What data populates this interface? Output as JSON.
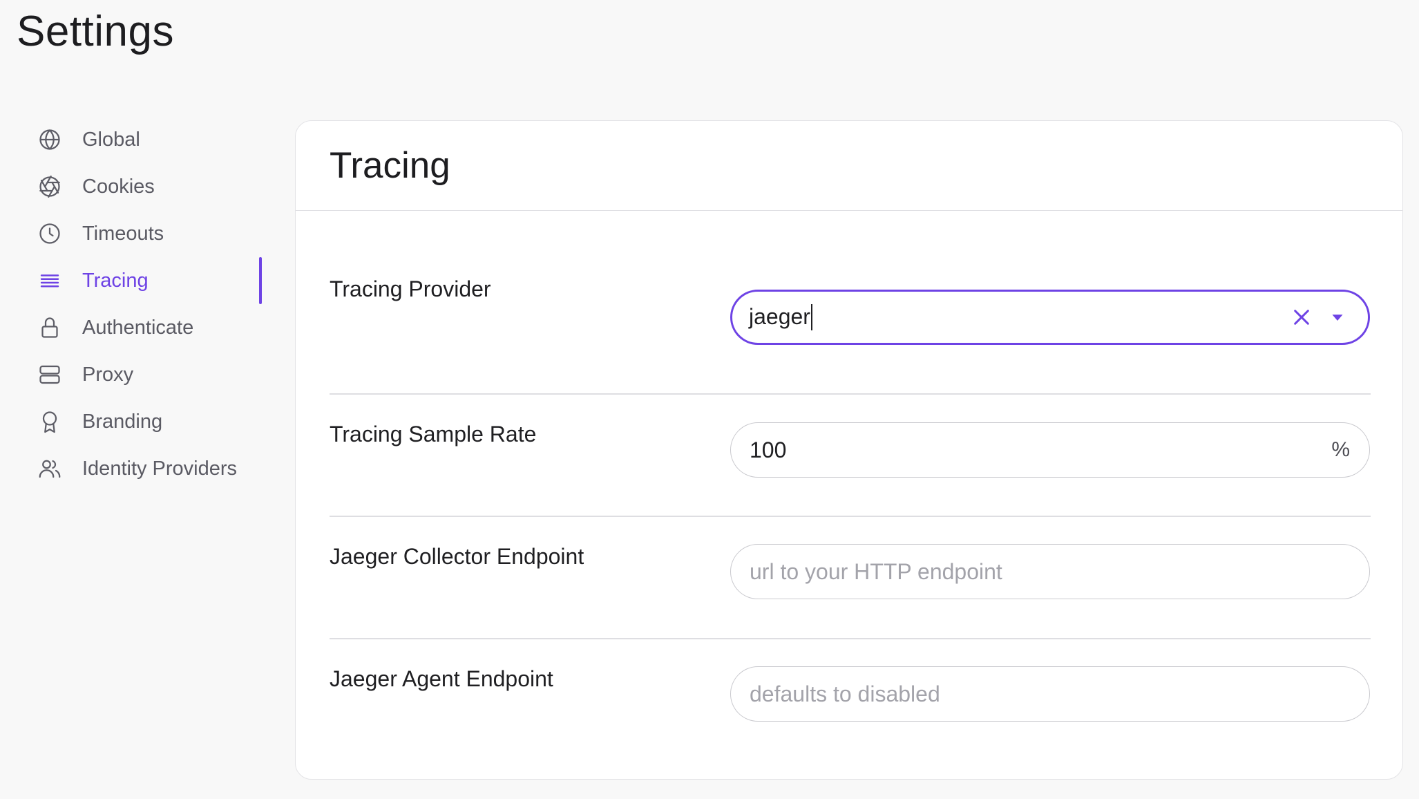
{
  "page": {
    "title": "Settings"
  },
  "sidebar": {
    "items": [
      {
        "label": "Global",
        "icon": "globe-icon",
        "active": false
      },
      {
        "label": "Cookies",
        "icon": "aperture-icon",
        "active": false
      },
      {
        "label": "Timeouts",
        "icon": "clock-icon",
        "active": false
      },
      {
        "label": "Tracing",
        "icon": "list-lines-icon",
        "active": true
      },
      {
        "label": "Authenticate",
        "icon": "lock-icon",
        "active": false
      },
      {
        "label": "Proxy",
        "icon": "server-icon",
        "active": false
      },
      {
        "label": "Branding",
        "icon": "award-icon",
        "active": false
      },
      {
        "label": "Identity Providers",
        "icon": "users-icon",
        "active": false
      }
    ]
  },
  "section": {
    "title": "Tracing",
    "fields": {
      "provider": {
        "label": "Tracing Provider",
        "value": "jaeger"
      },
      "sample_rate": {
        "label": "Tracing Sample Rate",
        "value": "100",
        "suffix": "%"
      },
      "collector": {
        "label": "Jaeger Collector Endpoint",
        "value": "",
        "placeholder": "url to your HTTP endpoint"
      },
      "agent": {
        "label": "Jaeger Agent Endpoint",
        "value": "",
        "placeholder": "defaults to disabled"
      }
    }
  },
  "colors": {
    "accent": "#6e43e5",
    "text": "#1f1f22",
    "muted": "#5a5a63",
    "border": "#c9c9ce"
  }
}
